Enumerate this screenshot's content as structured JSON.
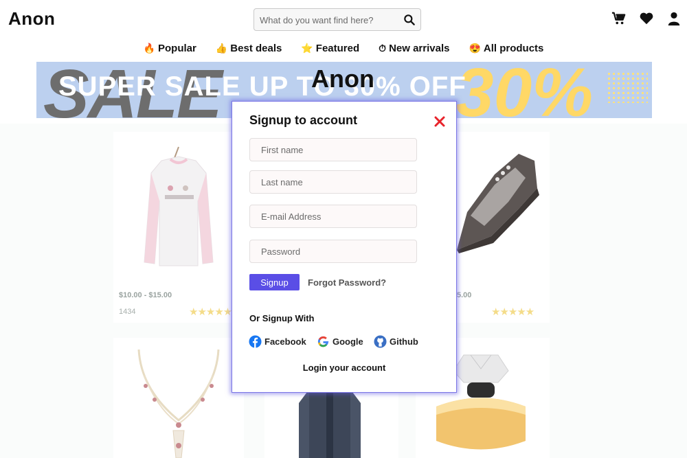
{
  "header": {
    "logo": "Anon",
    "search_placeholder": "What do you want find here?"
  },
  "nav": {
    "items": [
      {
        "emoji": "🔥",
        "label": "Popular"
      },
      {
        "emoji": "👍",
        "label": "Best deals"
      },
      {
        "emoji": "⭐",
        "label": "Featured"
      },
      {
        "emoji": "⏱",
        "label": "New arrivals"
      },
      {
        "emoji": "😍",
        "label": "All products"
      }
    ]
  },
  "banner": {
    "bg_text": "SALE",
    "headline": "SUPER SALE UP TO 30% OFF",
    "big_number": "30%",
    "brand": "Anon"
  },
  "products": [
    {
      "price": "$10.00 - $15.00",
      "sold": "1434",
      "rating": 5
    },
    {
      "price": "5.00",
      "rating": 5
    }
  ],
  "modal": {
    "title": "Signup to account",
    "fields": {
      "first_name": "First name",
      "last_name": "Last name",
      "email": "E-mail Address",
      "password": "Password"
    },
    "signup_label": "Signup",
    "forgot_label": "Forgot Password?",
    "or_signup_with": "Or Signup With",
    "social": {
      "facebook": "Facebook",
      "google": "Google",
      "github": "Github"
    },
    "login_label": "Login your account"
  },
  "colors": {
    "accent": "#5a4ee6",
    "close": "#e8232b",
    "star": "#f4dc89",
    "banner_bg": "#bcd0ef"
  }
}
